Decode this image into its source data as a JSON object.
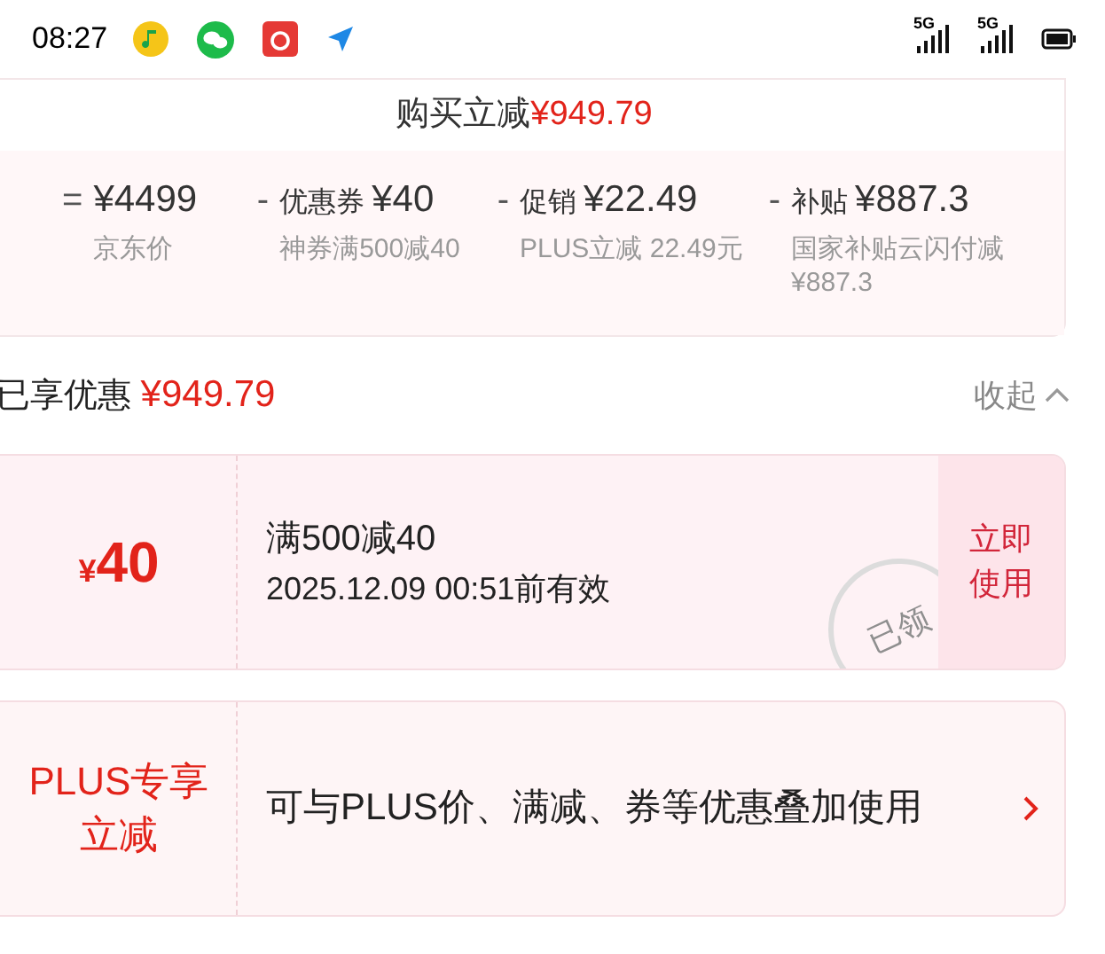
{
  "status_bar": {
    "time": "08:27",
    "app_icons": [
      {
        "kind": "music"
      },
      {
        "kind": "chat"
      },
      {
        "kind": "netease"
      },
      {
        "kind": "send"
      }
    ],
    "networks": [
      "5G",
      "5G"
    ]
  },
  "summary": {
    "label": "购买立减",
    "amount": "¥949.79"
  },
  "breakdown": [
    {
      "op": "=",
      "amount": "¥4499",
      "note": "京东价"
    },
    {
      "op": "-",
      "name": "优惠券",
      "amount": "¥40",
      "note": "神券满500减40"
    },
    {
      "op": "-",
      "name": "促销",
      "amount": "¥22.49",
      "note": "PLUS立减 22.49元"
    },
    {
      "op": "-",
      "name": "补贴",
      "amount": "¥887.3",
      "note": "国家补贴云闪付减¥887.3"
    }
  ],
  "discount_header": {
    "label": "已享优惠",
    "amount": "¥949.79",
    "toggle": "收起",
    "expanded": true
  },
  "offers": [
    {
      "kind": "coupon",
      "currency": "¥",
      "value": "40",
      "title": "满500减40",
      "subtitle": "2025.12.09 00:51前有效",
      "stamp": "已领",
      "action": "立即使用"
    },
    {
      "kind": "plus",
      "badge": "PLUS专享立减",
      "title": "可与PLUS价、满减、券等优惠叠加使用"
    }
  ]
}
